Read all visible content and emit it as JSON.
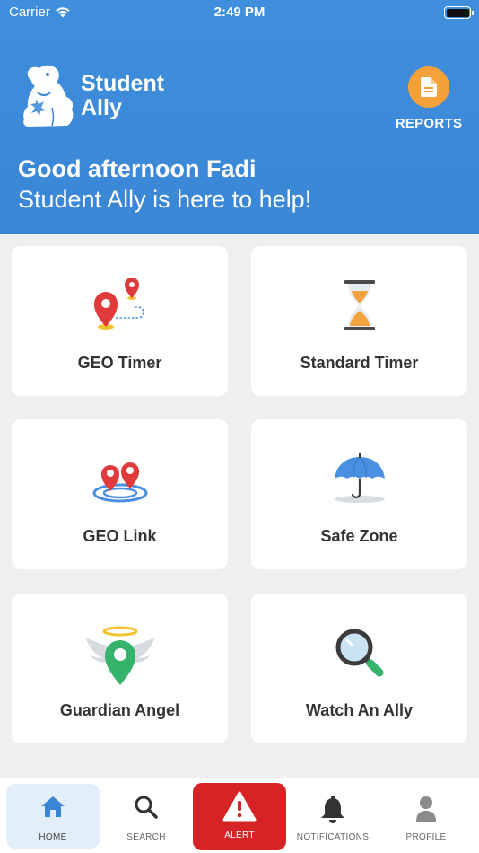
{
  "status_bar": {
    "carrier": "Carrier",
    "time": "2:49 PM"
  },
  "header": {
    "brand_line1": "Student",
    "brand_line2": "Ally",
    "reports_label": "REPORTS",
    "greeting": "Good afternoon Fadi",
    "subgreeting": "Student Ally is here to help!"
  },
  "cards": [
    {
      "label": "GEO Timer",
      "icon": "geo-timer-icon"
    },
    {
      "label": "Standard Timer",
      "icon": "hourglass-icon"
    },
    {
      "label": "GEO Link",
      "icon": "geo-link-icon"
    },
    {
      "label": "Safe Zone",
      "icon": "umbrella-icon"
    },
    {
      "label": "Guardian Angel",
      "icon": "guardian-angel-icon"
    },
    {
      "label": "Watch An Ally",
      "icon": "magnifier-icon"
    }
  ],
  "tabs": [
    {
      "label": "HOME",
      "icon": "home-icon",
      "active": true
    },
    {
      "label": "SEARCH",
      "icon": "search-icon"
    },
    {
      "label": "ALERT",
      "icon": "alert-icon"
    },
    {
      "label": "NOTIFICATIONS",
      "icon": "bell-icon"
    },
    {
      "label": "PROFILE",
      "icon": "person-icon"
    }
  ],
  "colors": {
    "header_blue": "#3a86d6",
    "reports_orange": "#f5a13a",
    "alert_red": "#d62426",
    "home_active_bg": "#e3eefb"
  }
}
